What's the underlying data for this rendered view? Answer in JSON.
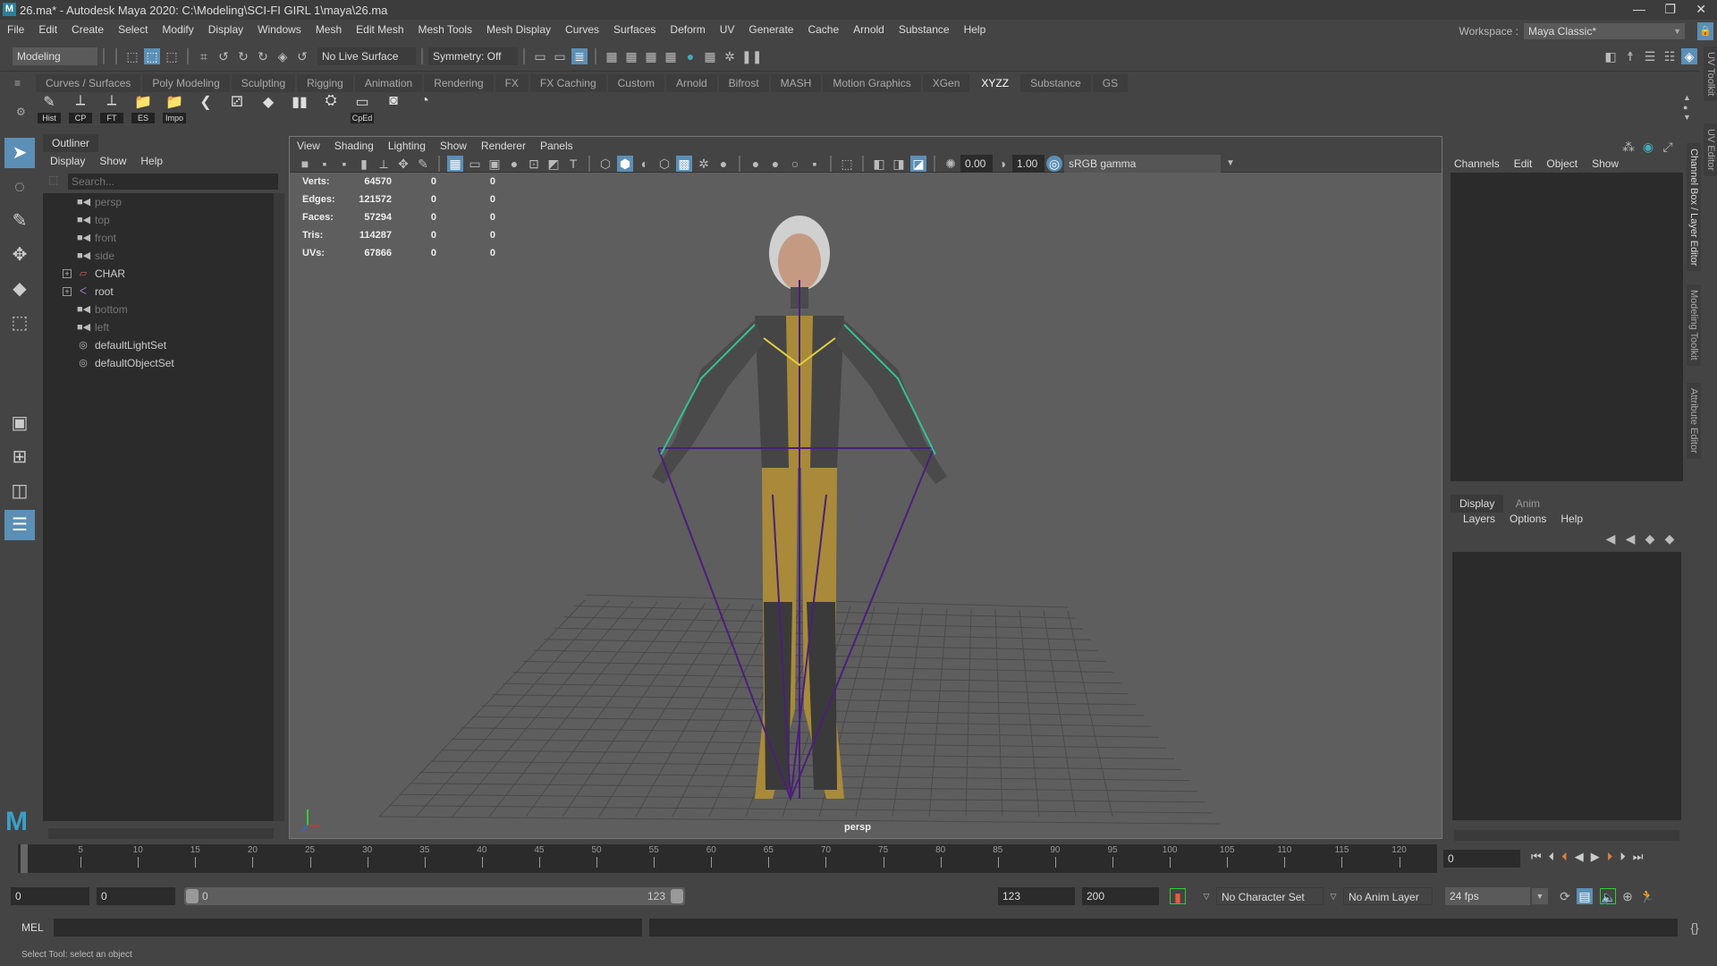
{
  "title": "26.ma* - Autodesk Maya 2020: C:\\Modeling\\SCI-FI GIRL 1\\maya\\26.ma",
  "menus": [
    "File",
    "Edit",
    "Create",
    "Select",
    "Modify",
    "Display",
    "Windows",
    "Mesh",
    "Edit Mesh",
    "Mesh Tools",
    "Mesh Display",
    "Curves",
    "Surfaces",
    "Deform",
    "UV",
    "Generate",
    "Cache",
    "Arnold",
    "Substance",
    "Help"
  ],
  "workspace": {
    "label": "Workspace :",
    "value": "Maya Classic*"
  },
  "status": {
    "mode": "Modeling",
    "live_surface": "No Live Surface",
    "symmetry": "Symmetry: Off"
  },
  "shelf_tabs": [
    "Curves / Surfaces",
    "Poly Modeling",
    "Sculpting",
    "Rigging",
    "Animation",
    "Rendering",
    "FX",
    "FX Caching",
    "Custom",
    "Arnold",
    "Bifrost",
    "MASH",
    "Motion Graphics",
    "XGen",
    "XYZZ",
    "Substance",
    "GS"
  ],
  "active_shelf": "XYZZ",
  "shelf_buttons": [
    "Hist",
    "CP",
    "FT",
    "ES",
    "Impo",
    "",
    "",
    "",
    "",
    "",
    "CpEd",
    "",
    ""
  ],
  "outliner": {
    "title": "Outliner",
    "menus": [
      "Display",
      "Show",
      "Help"
    ],
    "search_placeholder": "Search...",
    "items": [
      {
        "name": "persp",
        "type": "camera"
      },
      {
        "name": "top",
        "type": "camera"
      },
      {
        "name": "front",
        "type": "camera"
      },
      {
        "name": "side",
        "type": "camera"
      },
      {
        "name": "CHAR",
        "type": "group"
      },
      {
        "name": "root",
        "type": "joint"
      },
      {
        "name": "bottom",
        "type": "camera"
      },
      {
        "name": "left",
        "type": "camera"
      },
      {
        "name": "defaultLightSet",
        "type": "set"
      },
      {
        "name": "defaultObjectSet",
        "type": "set"
      }
    ]
  },
  "viewport": {
    "menus": [
      "View",
      "Shading",
      "Lighting",
      "Show",
      "Renderer",
      "Panels"
    ],
    "exposure": "0.00",
    "gamma": "1.00",
    "color_space": "sRGB gamma",
    "camera": "persp",
    "hud": [
      {
        "label": "Verts:",
        "v": "64570",
        "a": "0",
        "b": "0"
      },
      {
        "label": "Edges:",
        "v": "121572",
        "a": "0",
        "b": "0"
      },
      {
        "label": "Faces:",
        "v": "57294",
        "a": "0",
        "b": "0"
      },
      {
        "label": "Tris:",
        "v": "114287",
        "a": "0",
        "b": "0"
      },
      {
        "label": "UVs:",
        "v": "67866",
        "a": "0",
        "b": "0"
      }
    ]
  },
  "channel_box": {
    "menus": [
      "Channels",
      "Edit",
      "Object",
      "Show"
    ],
    "layer_tabs": [
      "Display",
      "Anim"
    ],
    "layer_menus": [
      "Layers",
      "Options",
      "Help"
    ]
  },
  "side_tabs": [
    "Channel Box / Layer Editor",
    "Modeling Toolkit",
    "Attribute Editor"
  ],
  "far_tabs": [
    "UV Toolkit",
    "UV Editor"
  ],
  "timeline": {
    "start": 0,
    "end": 123,
    "step": 5,
    "max_label": 120,
    "current": "0"
  },
  "range": {
    "start": "0",
    "anim_start": "0",
    "range_start": "0",
    "range_end": "123",
    "end": "123",
    "anim_end": "200"
  },
  "anim": {
    "character_set": "No Character Set",
    "anim_layer": "No Anim Layer",
    "fps": "24 fps"
  },
  "cmd": {
    "lang": "MEL"
  },
  "help_line": "Select Tool: select an object",
  "colors": {
    "accent": "#5b8fb5",
    "panel": "#444444",
    "field": "#2b2b2b",
    "viewport": "#5e5e5e"
  }
}
